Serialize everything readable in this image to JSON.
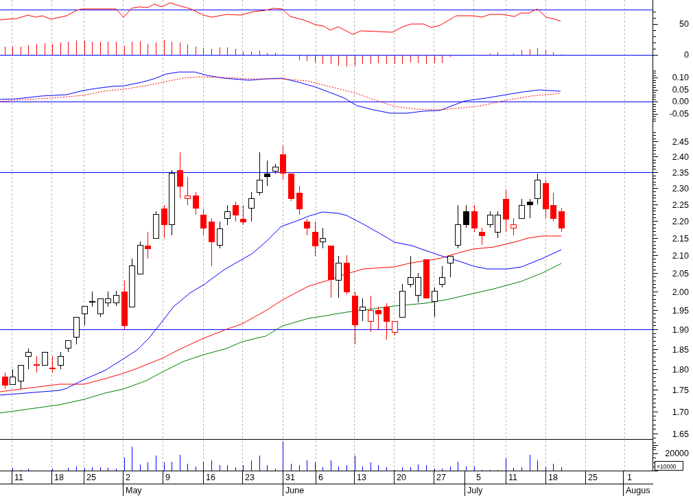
{
  "oscillator_panel": {
    "axis_labels": [
      "50",
      "0"
    ]
  },
  "macd_panel": {
    "axis_labels": [
      "0.10",
      "0.05",
      "0.00",
      "-0.05"
    ]
  },
  "price_panel": {
    "axis_labels": [
      "2.45",
      "2.40",
      "2.35",
      "2.30",
      "2.25",
      "2.20",
      "2.15",
      "2.10",
      "2.05",
      "2.00",
      "1.95",
      "1.90",
      "1.85",
      "1.80",
      "1.75",
      "1.70",
      "1.65"
    ]
  },
  "volume_panel": {
    "axis_labels": [
      "20000"
    ],
    "scale_badge": "×10000"
  },
  "date_axis": {
    "days": [
      "11",
      "18",
      "25",
      "2",
      "9",
      "16",
      "23",
      "31",
      "6",
      "13",
      "20",
      "27",
      "5",
      "11",
      "18",
      "25",
      "1"
    ],
    "months": [
      "May",
      "June",
      "July",
      "Augus"
    ]
  }
}
